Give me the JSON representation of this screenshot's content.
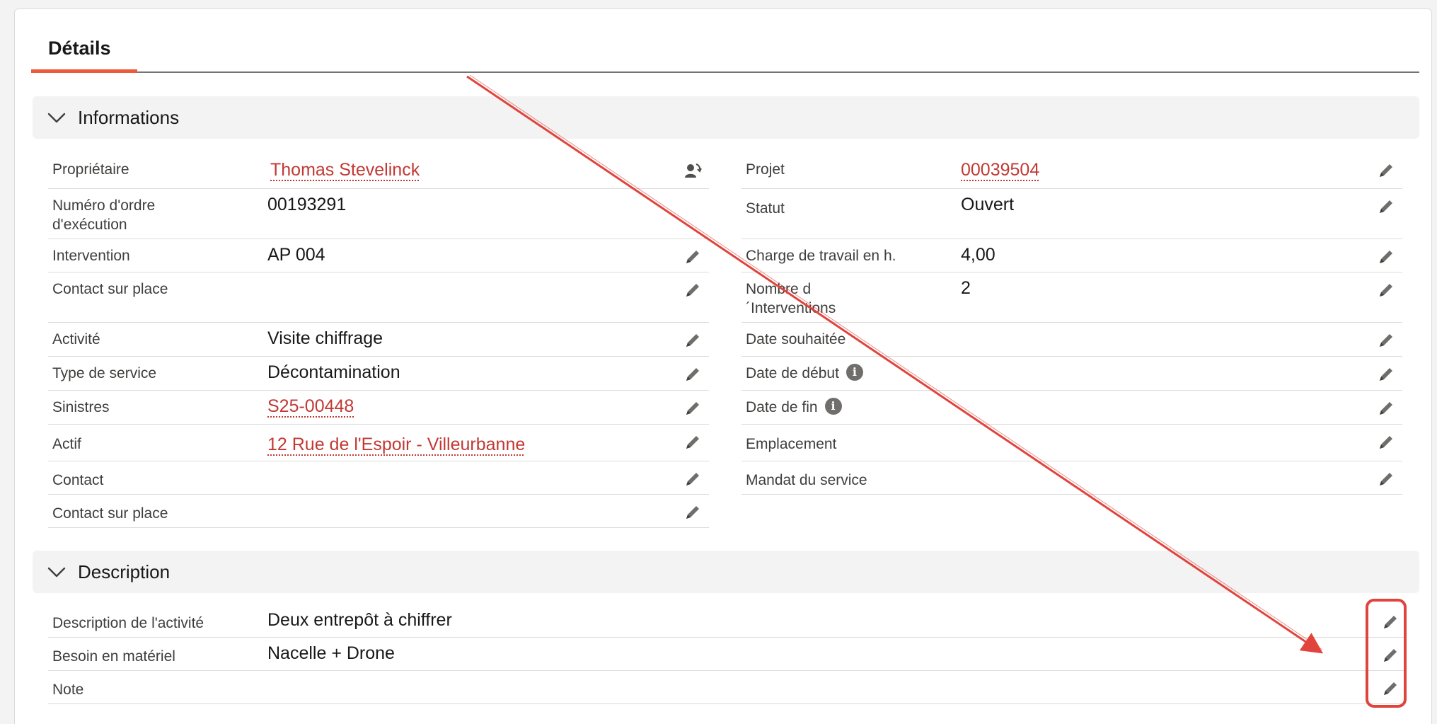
{
  "tabs": {
    "details_label": "Détails"
  },
  "sections": {
    "informations": "Informations",
    "description": "Description"
  },
  "left_fields": [
    {
      "label": "Propriétaire",
      "value": "Thomas Stevelinck",
      "link": true,
      "icon": "change-owner-icon"
    },
    {
      "label": "Numéro d'ordre d'exécution",
      "value": "00193291",
      "link": false,
      "icon": ""
    },
    {
      "label": "Intervention",
      "value": "AP 004",
      "link": false,
      "icon": "pencil-icon"
    },
    {
      "label": "Contact sur place",
      "value": "",
      "link": false,
      "icon": "pencil-icon"
    },
    {
      "label": "Activité",
      "value": "Visite chiffrage",
      "link": false,
      "icon": "pencil-icon"
    },
    {
      "label": "Type de service",
      "value": "Décontamination",
      "link": false,
      "icon": "pencil-icon"
    },
    {
      "label": "Sinistres",
      "value": "S25-00448",
      "link": true,
      "icon": "pencil-icon"
    },
    {
      "label": "Actif",
      "value": "12 Rue de l'Espoir - Villeurbanne",
      "link": true,
      "icon": "pencil-icon"
    },
    {
      "label": "Contact",
      "value": "",
      "link": false,
      "icon": "pencil-icon"
    },
    {
      "label": "Contact sur place",
      "value": "",
      "link": false,
      "icon": "pencil-icon"
    }
  ],
  "right_fields": [
    {
      "label": "Projet",
      "value": "00039504",
      "link": true,
      "icon": "pencil-icon"
    },
    {
      "label": "Statut",
      "value": "Ouvert",
      "link": false,
      "icon": "pencil-icon"
    },
    {
      "label": "Charge de travail en h.",
      "value": "4,00",
      "link": false,
      "icon": "pencil-icon"
    },
    {
      "label": "Nombre d ´Interventions",
      "value": "2",
      "link": false,
      "icon": "pencil-icon"
    },
    {
      "label": "Date souhaitée",
      "value": "",
      "link": false,
      "icon": "pencil-icon"
    },
    {
      "label": "Date de début",
      "value": "",
      "link": false,
      "icon": "pencil-icon",
      "info": true
    },
    {
      "label": "Date de fin",
      "value": "",
      "link": false,
      "icon": "pencil-icon",
      "info": true
    },
    {
      "label": "Emplacement",
      "value": "",
      "link": false,
      "icon": "pencil-icon"
    },
    {
      "label": "Mandat du service",
      "value": "",
      "link": false,
      "icon": "pencil-icon"
    }
  ],
  "description_fields": [
    {
      "label": "Description de l'activité",
      "value": "Deux entrepôt à chiffrer",
      "icon": "pencil-icon"
    },
    {
      "label": "Besoin en matériel",
      "value": "Nacelle + Drone",
      "icon": "pencil-icon"
    },
    {
      "label": "Note",
      "value": "",
      "icon": "pencil-icon"
    }
  ],
  "info_glyph": "i",
  "colors": {
    "accent": "#ee5a3c",
    "link": "#c23934",
    "annotation": "#e0443c"
  }
}
